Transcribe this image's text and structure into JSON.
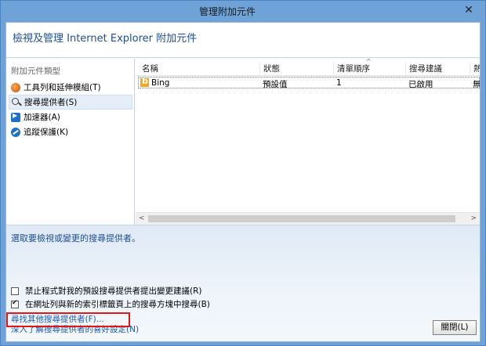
{
  "window": {
    "title": "管理附加元件",
    "close_symbol": "✕"
  },
  "header": {
    "heading": "檢視及管理 Internet Explorer 附加元件"
  },
  "sidebar": {
    "category_label": "附加元件類型",
    "items": [
      {
        "label": "工具列和延伸模組(T)",
        "icon": "toolbar-icon"
      },
      {
        "label": "搜尋提供者(S)",
        "icon": "search-icon",
        "selected": true
      },
      {
        "label": "加速器(A)",
        "icon": "accelerator-icon"
      },
      {
        "label": "追蹤保護(K)",
        "icon": "tracking-protection-icon"
      }
    ]
  },
  "table": {
    "columns": [
      "名稱",
      "狀態",
      "清單順序",
      "搜尋建議",
      "熱"
    ],
    "sort_symbol": "^",
    "rows": [
      {
        "name": "Bing",
        "status": "預設值",
        "order": "1",
        "suggestions": "已啟用",
        "extra": "無"
      }
    ]
  },
  "scrollbar": {
    "left": "<",
    "right": ">"
  },
  "details": {
    "prompt": "選取要檢視或變更的搜尋提供者。"
  },
  "options": {
    "prevent_prompt": {
      "label": "禁止程式對我的預設搜尋提供者提出變更建議(R)",
      "checked": false
    },
    "search_address_bar": {
      "label": "在網址列與新的索引標籤頁上的搜尋方塊中搜尋(B)",
      "checked": true
    }
  },
  "footer": {
    "find_more_link": "尋找其他搜尋提供者(F)...",
    "learn_more_link": "深入了解搜尋提供者的喜好設定(N)",
    "close_button": "關閉(L)"
  },
  "colors": {
    "frame": "#6fa3d8",
    "link": "#1a5bb5",
    "heading": "#1e4e9a",
    "highlight": "#e01818"
  }
}
